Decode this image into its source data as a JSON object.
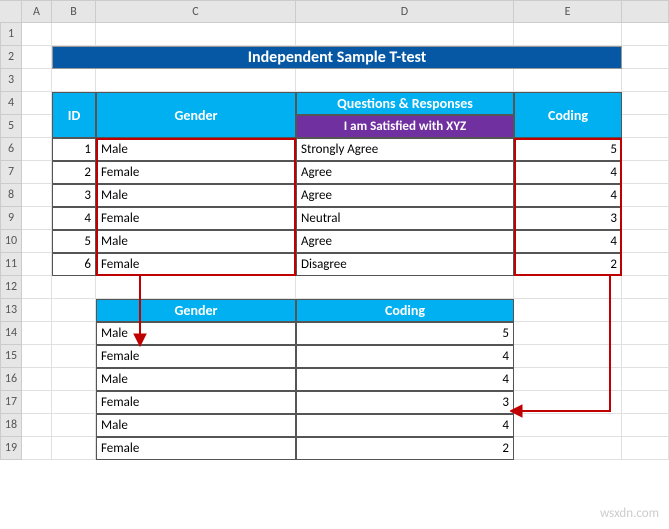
{
  "columns": [
    "A",
    "B",
    "C",
    "D",
    "E"
  ],
  "rows": [
    "1",
    "2",
    "3",
    "4",
    "5",
    "6",
    "7",
    "8",
    "9",
    "10",
    "11",
    "12",
    "13",
    "14",
    "15",
    "16",
    "17",
    "18",
    "19"
  ],
  "title": "Independent Sample T-test",
  "table1": {
    "headers": {
      "id": "ID",
      "gender": "Gender",
      "questions": "Questions & Responses",
      "satisfied": "I am Satisfied with XYZ",
      "coding": "Coding"
    },
    "rows": [
      {
        "id": "1",
        "gender": "Male",
        "response": "Strongly Agree",
        "code": "5"
      },
      {
        "id": "2",
        "gender": "Female",
        "response": "Agree",
        "code": "4"
      },
      {
        "id": "3",
        "gender": "Male",
        "response": "Agree",
        "code": "4"
      },
      {
        "id": "4",
        "gender": "Female",
        "response": "Neutral",
        "code": "3"
      },
      {
        "id": "5",
        "gender": "Male",
        "response": "Agree",
        "code": "4"
      },
      {
        "id": "6",
        "gender": "Female",
        "response": "Disagree",
        "code": "2"
      }
    ]
  },
  "table2": {
    "headers": {
      "gender": "Gender",
      "coding": "Coding"
    },
    "rows": [
      {
        "gender": "Male",
        "code": "5"
      },
      {
        "gender": "Female",
        "code": "4"
      },
      {
        "gender": "Male",
        "code": "4"
      },
      {
        "gender": "Female",
        "code": "3"
      },
      {
        "gender": "Male",
        "code": "4"
      },
      {
        "gender": "Female",
        "code": "2"
      }
    ]
  },
  "watermark": "wsxdn.com"
}
